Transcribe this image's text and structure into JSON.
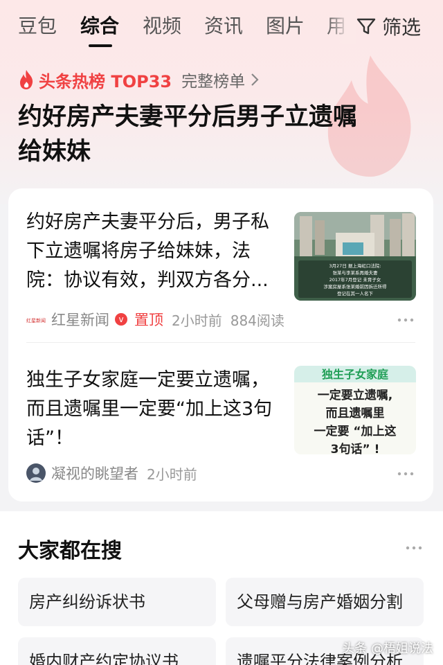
{
  "tabs": [
    {
      "label": "豆包",
      "active": false
    },
    {
      "label": "综合",
      "active": true
    },
    {
      "label": "视频",
      "active": false
    },
    {
      "label": "资讯",
      "active": false
    },
    {
      "label": "图片",
      "active": false
    },
    {
      "label": "用",
      "active": false
    }
  ],
  "filter_label": "筛选",
  "hot": {
    "title": "头条热榜 TOP33",
    "link": "完整榜单",
    "headline_line1": "约好房产夫妻平分后男子立遗嘱",
    "headline_line2": "给妹妹"
  },
  "news": [
    {
      "line1": "约好房产夫妻平分后，男子私",
      "line2": "下立遗嘱将房子给妹妹，法",
      "line3": "院：协议有效，判双方各分...",
      "source": "红星新闻",
      "source_logo": "红星新闻",
      "pinned": "置顶",
      "time": "2小时前",
      "reads": "884阅读",
      "thumb_caption": [
        "3月27日 据上海虹口法院:",
        "张某与李某系再婚夫妻",
        "2017年7月登记 未育子女",
        "涉案房屋系张某婚前因拆迁所得",
        "登记在其一人名下"
      ]
    },
    {
      "line1": "独生子女家庭一定要立遗嘱，",
      "line2": "而且遗嘱里一定要“加上这3句",
      "line3": "话”！",
      "source": "凝视的眺望者",
      "time": "2小时前",
      "thumb_lines": [
        "独生子女家庭",
        "一定要立遗嘱,",
        "而且遗嘱里",
        "一定要 “加上这",
        "3句话” !"
      ]
    }
  ],
  "search": {
    "title": "大家都在搜",
    "chips": [
      "房产纠纷诉状书",
      "父母赠与房产婚姻分割",
      "婚内财产约定协议书",
      "遗嘱平分法律案例分析"
    ]
  },
  "watermark": "头条 @梧姐说法",
  "colors": {
    "accent": "#f04142",
    "pinned": "#e5622a",
    "background": "#f3f3f5"
  }
}
